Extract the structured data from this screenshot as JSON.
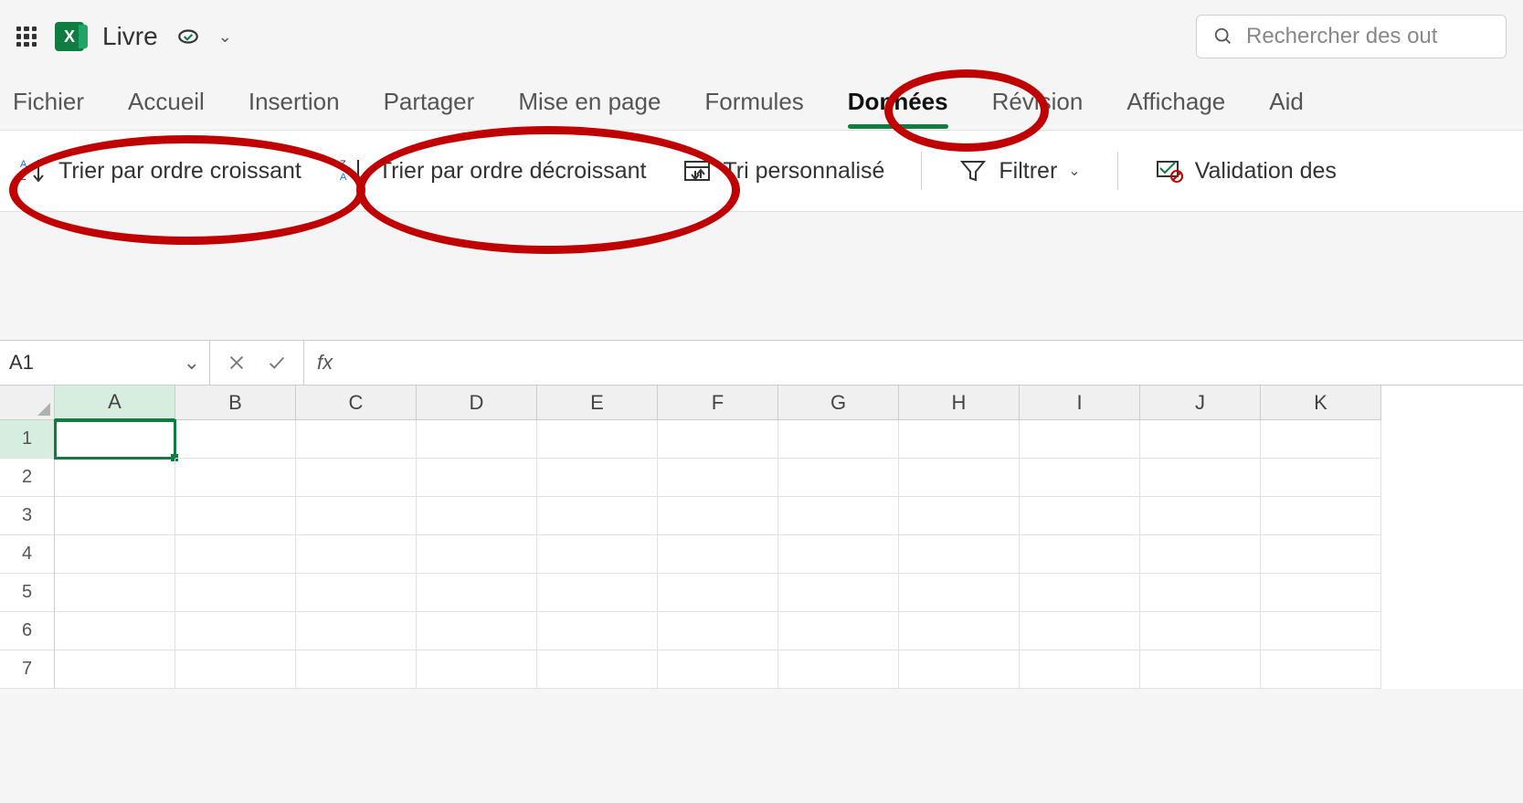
{
  "title_bar": {
    "doc_name": "Livre",
    "search_placeholder": "Rechercher des out"
  },
  "tabs": [
    {
      "label": "Fichier",
      "active": false
    },
    {
      "label": "Accueil",
      "active": false
    },
    {
      "label": "Insertion",
      "active": false
    },
    {
      "label": "Partager",
      "active": false
    },
    {
      "label": "Mise en page",
      "active": false
    },
    {
      "label": "Formules",
      "active": false
    },
    {
      "label": "Données",
      "active": true
    },
    {
      "label": "Révision",
      "active": false
    },
    {
      "label": "Affichage",
      "active": false
    },
    {
      "label": "Aid",
      "active": false
    }
  ],
  "ribbon": {
    "sort_asc": "Trier par ordre croissant",
    "sort_desc": "Trier par ordre décroissant",
    "custom_sort": "Tri personnalisé",
    "filter": "Filtrer",
    "validation": "Validation des"
  },
  "formula_bar": {
    "name_box": "A1",
    "fx_label": "fx"
  },
  "grid": {
    "columns": [
      "A",
      "B",
      "C",
      "D",
      "E",
      "F",
      "G",
      "H",
      "I",
      "J",
      "K"
    ],
    "rows": [
      "1",
      "2",
      "3",
      "4",
      "5",
      "6",
      "7"
    ],
    "selected_cell": "A1"
  }
}
